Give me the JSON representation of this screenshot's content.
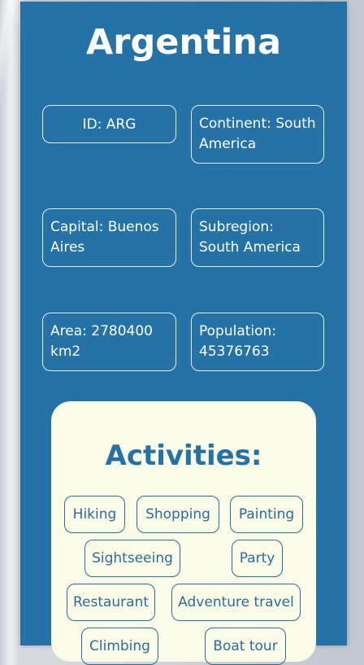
{
  "country": {
    "name": "Argentina",
    "id": "ID: ARG",
    "continent": "Continent: South America",
    "capital": "Capital: Buenos Aires",
    "subregion": "Subregion: South America",
    "area": "Area: 2780400 km2",
    "population": "Population: 45376763"
  },
  "activities": {
    "heading": "Activities:",
    "items": [
      "Hiking",
      "Shopping",
      "Painting",
      "Sightseeing",
      "Party",
      "Restaurant",
      "Adventure travel",
      "Climbing",
      "Boat tour"
    ]
  }
}
